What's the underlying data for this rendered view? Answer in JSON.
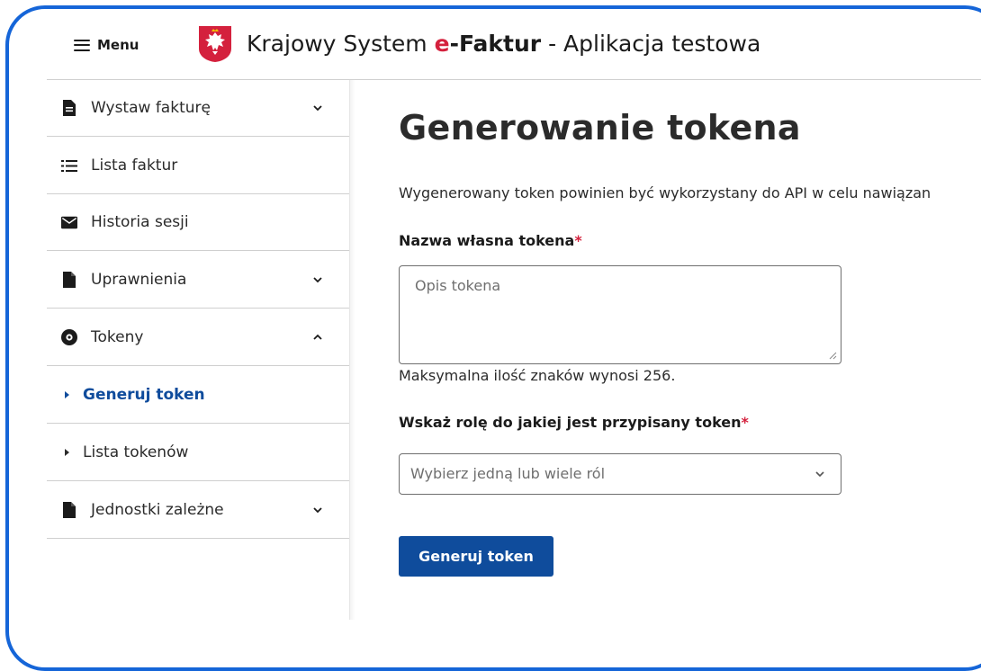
{
  "header": {
    "menu_label": "Menu",
    "title_prefix": "Krajowy System ",
    "title_brand_e": "e",
    "title_brand_rest": "-Faktur",
    "title_suffix": " - Aplikacja testowa"
  },
  "sidebar": {
    "items": [
      {
        "label": "Wystaw fakturę",
        "icon": "document-icon",
        "chevron": "down"
      },
      {
        "label": "Lista faktur",
        "icon": "list-icon"
      },
      {
        "label": "Historia sesji",
        "icon": "envelope-icon"
      },
      {
        "label": "Uprawnienia",
        "icon": "file-icon",
        "chevron": "down"
      },
      {
        "label": "Tokeny",
        "icon": "token-icon",
        "chevron": "up"
      },
      {
        "label": "Generuj token",
        "sub": true,
        "active": true
      },
      {
        "label": "Lista tokenów",
        "sub": true
      },
      {
        "label": "Jednostki zależne",
        "icon": "file-icon",
        "chevron": "down"
      }
    ]
  },
  "main": {
    "title": "Generowanie tokena",
    "description": "Wygenerowany token powinien być wykorzystany do API w celu nawiązan",
    "token_name": {
      "label": "Nazwa własna tokena",
      "required_mark": "*",
      "placeholder": "Opis tokena",
      "value": "",
      "hint": "Maksymalna ilość znaków wynosi 256."
    },
    "role_select": {
      "label": "Wskaż rolę do jakiej jest przypisany token",
      "required_mark": "*",
      "placeholder": "Wybierz jedną lub wiele ról"
    },
    "submit_label": "Generuj token"
  },
  "colors": {
    "accent": "#0f4c9c",
    "brand_red": "#d4213d",
    "frame": "#1565d8"
  }
}
